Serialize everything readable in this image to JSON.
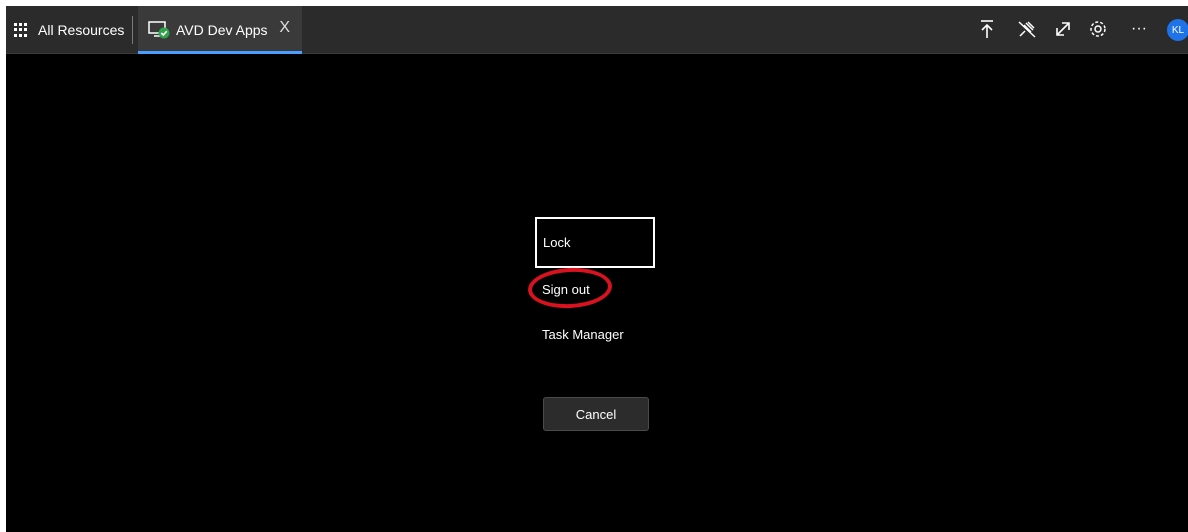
{
  "topbar": {
    "all_resources_label": "All Resources",
    "active_tab_label": "AVD Dev Apps",
    "close_glyph": "X",
    "avatar_initials": "KL",
    "more_glyph": "···"
  },
  "menu": {
    "lock_label": "Lock",
    "sign_out_label": "Sign out",
    "task_manager_label": "Task Manager",
    "cancel_label": "Cancel"
  },
  "colors": {
    "background": "#000000",
    "topbar": "#2b2b2b",
    "active_tab_underline": "#4a9eff",
    "annotation_red": "#d8121f",
    "avatar_blue": "#1e73e8"
  },
  "icons": [
    "apps-grid-icon",
    "computer-check-icon",
    "close-icon",
    "pin-top-icon",
    "unpin-icon",
    "expand-icon",
    "settings-icon",
    "more-icon"
  ]
}
